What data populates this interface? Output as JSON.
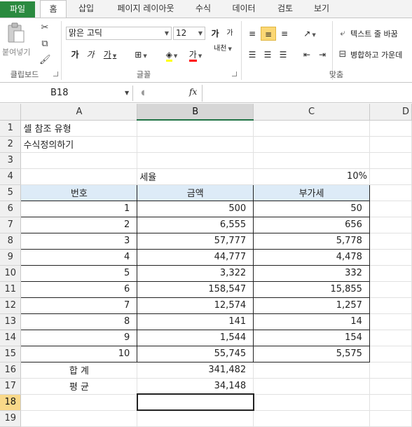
{
  "tabs": [
    "파일",
    "홈",
    "삽입",
    "페이지 레이아웃",
    "수식",
    "데이터",
    "검토",
    "보기"
  ],
  "ribbon": {
    "clipboard": {
      "paste_label": "붙여넣기",
      "group_label": "클립보드"
    },
    "font": {
      "name": "맑은 고딕",
      "size": "12",
      "grow_label": "가",
      "shrink_label": "가",
      "bold_label": "가",
      "italic_label": "가",
      "underline_label": "가",
      "phonetic_label": "내천",
      "group_label": "글꼴",
      "fill_color": "#ffff00",
      "font_color": "#ff0000"
    },
    "alignment": {
      "wrap_text_label": "텍스트 줄 바꿈",
      "merge_label": "병합하고 가운데",
      "group_label": "맞춤"
    }
  },
  "formula_bar": {
    "name_box": "B18",
    "fx_label": "fx",
    "value": ""
  },
  "sheet": {
    "columns": [
      "A",
      "B",
      "C",
      "D"
    ],
    "rows": [
      {
        "n": "1",
        "a": "셀 참조 유형",
        "b": "",
        "c": ""
      },
      {
        "n": "2",
        "a": "수식정의하기",
        "b": "",
        "c": ""
      },
      {
        "n": "3",
        "a": "",
        "b": "",
        "c": ""
      },
      {
        "n": "4",
        "a": "",
        "b": "세율",
        "c": "10%"
      },
      {
        "n": "5",
        "a": "번호",
        "b": "금액",
        "c": "부가세"
      },
      {
        "n": "6",
        "a": "1",
        "b": "500",
        "c": "50"
      },
      {
        "n": "7",
        "a": "2",
        "b": "6,555",
        "c": "656"
      },
      {
        "n": "8",
        "a": "3",
        "b": "57,777",
        "c": "5,778"
      },
      {
        "n": "9",
        "a": "4",
        "b": "44,777",
        "c": "4,478"
      },
      {
        "n": "10",
        "a": "5",
        "b": "3,322",
        "c": "332"
      },
      {
        "n": "11",
        "a": "6",
        "b": "158,547",
        "c": "15,855"
      },
      {
        "n": "12",
        "a": "7",
        "b": "12,574",
        "c": "1,257"
      },
      {
        "n": "13",
        "a": "8",
        "b": "141",
        "c": "14"
      },
      {
        "n": "14",
        "a": "9",
        "b": "1,544",
        "c": "154"
      },
      {
        "n": "15",
        "a": "10",
        "b": "55,745",
        "c": "5,575"
      },
      {
        "n": "16",
        "a": "합 계",
        "b": "341,482",
        "c": ""
      },
      {
        "n": "17",
        "a": "평 균",
        "b": "34,148",
        "c": ""
      },
      {
        "n": "18",
        "a": "",
        "b": "",
        "c": ""
      },
      {
        "n": "19",
        "a": "",
        "b": "",
        "c": ""
      }
    ]
  },
  "colors": {
    "file_tab": "#2a8a3f",
    "header_fill": "#ddebf7",
    "selected_header": "#f9d889"
  }
}
